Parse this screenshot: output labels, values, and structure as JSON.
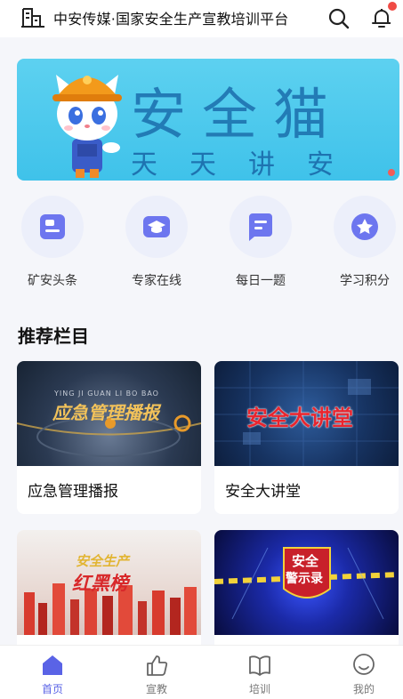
{
  "header": {
    "title": "中安传媒·国家安全生产宣教培训平台",
    "icons": [
      "building-icon",
      "search-icon",
      "bell-icon"
    ]
  },
  "banner": {
    "title": "安全猫",
    "subtitle": "天天讲安全"
  },
  "quick_menu": [
    {
      "label": "矿安头条",
      "icon": "news-icon"
    },
    {
      "label": "专家在线",
      "icon": "graduation-cap-icon"
    },
    {
      "label": "每日一题",
      "icon": "quiz-icon"
    },
    {
      "label": "学习积分",
      "icon": "star-badge-icon"
    }
  ],
  "section": {
    "title": "推荐栏目"
  },
  "cards": [
    {
      "title": "应急管理播报",
      "thumb_text": "应急管理播报",
      "thumb_sub": "YING JI GUAN LI BO BAO"
    },
    {
      "title": "安全大讲堂",
      "thumb_text": "安全大讲堂"
    },
    {
      "thumb_text_top": "安全生产",
      "thumb_text_bottom": "红黑榜"
    },
    {
      "thumb_text_top": "安全",
      "thumb_text_bottom": "警示录"
    }
  ],
  "bottom_nav": [
    {
      "label": "首页",
      "icon": "home-icon",
      "active": true
    },
    {
      "label": "宣教",
      "icon": "thumbs-up-icon",
      "active": false
    },
    {
      "label": "培训",
      "icon": "book-icon",
      "active": false
    },
    {
      "label": "我的",
      "icon": "user-smile-icon",
      "active": false
    }
  ],
  "colors": {
    "accent": "#5a63e6",
    "banner_bg": "#3fc2ea",
    "notification": "#f04b45"
  }
}
